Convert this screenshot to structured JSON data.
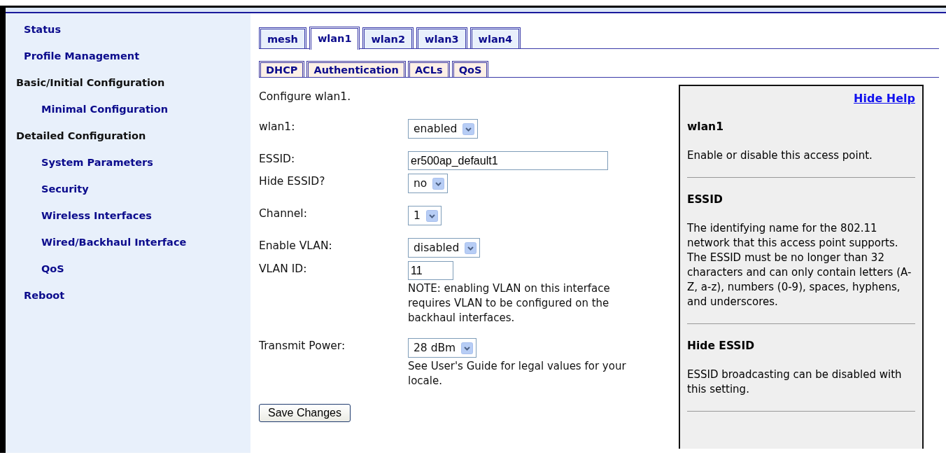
{
  "sidebar": {
    "items": [
      {
        "label": "Status",
        "kind": "link"
      },
      {
        "label": "Profile Management",
        "kind": "link"
      },
      {
        "label": "Basic/Initial Configuration",
        "kind": "heading",
        "children": [
          {
            "label": "Minimal Configuration",
            "kind": "link"
          }
        ]
      },
      {
        "label": "Detailed Configuration",
        "kind": "heading",
        "children": [
          {
            "label": "System Parameters",
            "kind": "link"
          },
          {
            "label": "Security",
            "kind": "link"
          },
          {
            "label": "Wireless Interfaces",
            "kind": "link"
          },
          {
            "label": "Wired/Backhaul Interface",
            "kind": "link"
          },
          {
            "label": "QoS",
            "kind": "link"
          }
        ]
      },
      {
        "label": "Reboot",
        "kind": "link"
      }
    ]
  },
  "tabs": [
    {
      "label": "mesh",
      "selected": false
    },
    {
      "label": "wlan1",
      "selected": true
    },
    {
      "label": "wlan2",
      "selected": false
    },
    {
      "label": "wlan3",
      "selected": false
    },
    {
      "label": "wlan4",
      "selected": false
    }
  ],
  "subtabs": [
    {
      "label": "DHCP",
      "selected": false
    },
    {
      "label": "Authentication",
      "selected": false
    },
    {
      "label": "ACLs",
      "selected": false
    },
    {
      "label": "QoS",
      "selected": false
    }
  ],
  "intro": "Configure wlan1.",
  "form_groups": [
    [
      {
        "label": "wlan1:",
        "kind": "select",
        "value": "enabled"
      }
    ],
    [
      {
        "label": "ESSID:",
        "kind": "text",
        "value": "er500ap_default1"
      },
      {
        "label": "Hide ESSID?",
        "kind": "select",
        "value": "no"
      }
    ],
    [
      {
        "label": "Channel:",
        "kind": "select",
        "value": "1"
      }
    ],
    [
      {
        "label": "Enable VLAN:",
        "kind": "select",
        "value": "disabled"
      },
      {
        "label": "VLAN ID:",
        "kind": "text",
        "value": "11",
        "note": "NOTE: enabling VLAN on this interface requires VLAN to be configured on the backhaul interfaces."
      }
    ],
    [
      {
        "label": "Transmit Power:",
        "kind": "select",
        "value": "28 dBm",
        "note": "See User's Guide for legal values for your locale."
      }
    ]
  ],
  "save_button": "Save Changes",
  "help": {
    "link": "Hide Help",
    "sections": [
      {
        "title": "wlan1",
        "text": "Enable or disable this access point."
      },
      {
        "title": "ESSID",
        "text": "The identifying name for the 802.11 network that this access point supports. The ESSID must be no longer than 32 characters and can only contain letters (A-Z, a-z), numbers (0-9), spaces, hyphens, and underscores."
      },
      {
        "title": "Hide ESSID",
        "text": "ESSID broadcasting can be disabled with this setting."
      }
    ]
  }
}
